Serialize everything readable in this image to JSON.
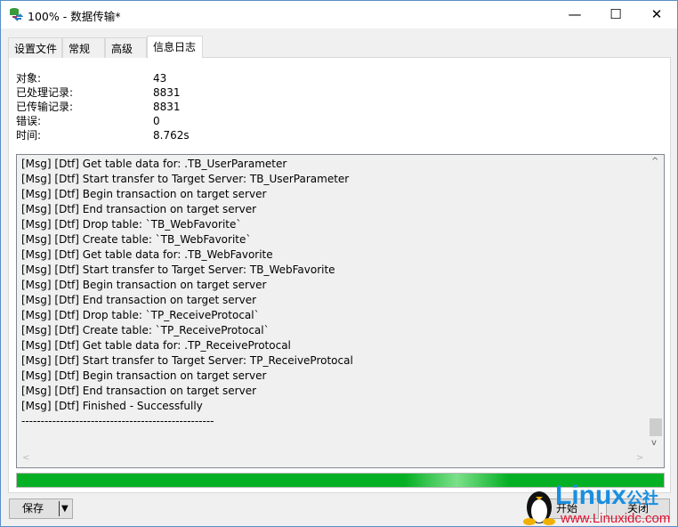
{
  "window": {
    "title": "100% - 数据传输*",
    "minimize": "—",
    "maximize": "☐",
    "close": "✕"
  },
  "tabs": [
    {
      "label": "设置文件"
    },
    {
      "label": "常规"
    },
    {
      "label": "高级"
    },
    {
      "label": "信息日志",
      "active": true
    }
  ],
  "info": [
    {
      "label": "对象:",
      "value": "43"
    },
    {
      "label": "已处理记录:",
      "value": "8831"
    },
    {
      "label": "已传输记录:",
      "value": "8831"
    },
    {
      "label": "错误:",
      "value": "0"
    },
    {
      "label": "时间:",
      "value": "8.762s"
    }
  ],
  "log": [
    "[Msg] [Dtf] Get table data for: .TB_UserParameter",
    "[Msg] [Dtf] Start transfer to Target Server: TB_UserParameter",
    "[Msg] [Dtf] Begin transaction on target server",
    "[Msg] [Dtf] End transaction on target server",
    "[Msg] [Dtf] Drop table: `TB_WebFavorite`",
    "[Msg] [Dtf] Create table: `TB_WebFavorite`",
    "[Msg] [Dtf] Get table data for: .TB_WebFavorite",
    "[Msg] [Dtf] Start transfer to Target Server: TB_WebFavorite",
    "[Msg] [Dtf] Begin transaction on target server",
    "[Msg] [Dtf] End transaction on target server",
    "[Msg] [Dtf] Drop table: `TP_ReceiveProtocal`",
    "[Msg] [Dtf] Create table: `TP_ReceiveProtocal`",
    "[Msg] [Dtf] Get table data for: .TP_ReceiveProtocal",
    "[Msg] [Dtf] Start transfer to Target Server: TP_ReceiveProtocal",
    "[Msg] [Dtf] Begin transaction on target server",
    "[Msg] [Dtf] End transaction on target server",
    "[Msg] [Dtf] Finished - Successfully",
    "--------------------------------------------------"
  ],
  "progress": {
    "percent": 100,
    "color": "#06b025"
  },
  "buttons": {
    "save": "保存",
    "start": "开始",
    "close": "关闭"
  },
  "watermark": {
    "brand": "Linux公社",
    "url": "www.Linuxidc.com"
  }
}
